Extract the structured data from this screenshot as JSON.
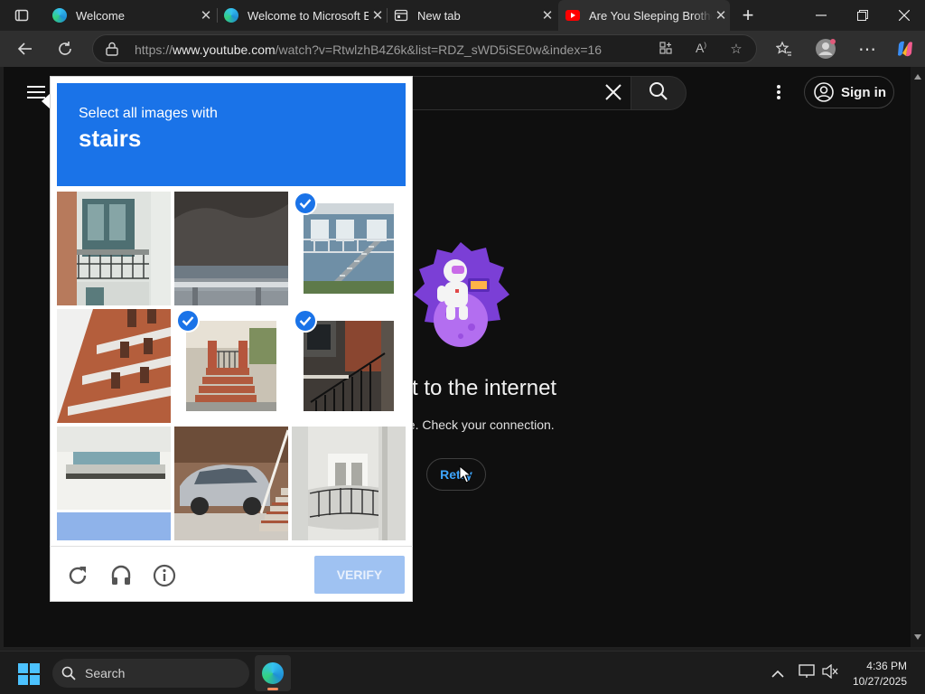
{
  "tabs": [
    {
      "title": "Welcome",
      "favicon": "edge-icon"
    },
    {
      "title": "Welcome to Microsoft E",
      "favicon": "edge-icon"
    },
    {
      "title": "New tab",
      "favicon": "new-tab-icon"
    },
    {
      "title": "Are You Sleeping Brothe",
      "favicon": "youtube-icon",
      "active": true
    }
  ],
  "address": {
    "prefix": "https://",
    "domain": "www.youtube.com",
    "path": "/watch?v=RtwlzhB4Z6k&list=RDZ_sWD5iSE0w&index=16"
  },
  "youtube": {
    "signin_label": "Sign in",
    "offline_title": "ct to the internet",
    "offline_subtitle": "ne. Check your connection.",
    "retry_label": "Retry"
  },
  "captcha": {
    "prompt": "Select all images with",
    "target": "stairs",
    "verify_label": "VERIFY",
    "tiles": [
      {
        "index": 1,
        "selected": false
      },
      {
        "index": 2,
        "selected": false
      },
      {
        "index": 3,
        "selected": true
      },
      {
        "index": 4,
        "selected": false
      },
      {
        "index": 5,
        "selected": true
      },
      {
        "index": 6,
        "selected": true
      },
      {
        "index": 7,
        "selected": false
      },
      {
        "index": 8,
        "selected": false
      },
      {
        "index": 9,
        "selected": false
      }
    ]
  },
  "taskbar": {
    "search_label": "Search",
    "time": "4:36 PM",
    "date": "10/27/2025"
  },
  "colors": {
    "captcha_blue": "#1a73e8",
    "verify_disabled": "#9fc2f2",
    "youtube_bg": "#0f0f0f",
    "link_blue": "#3ea6ff"
  }
}
